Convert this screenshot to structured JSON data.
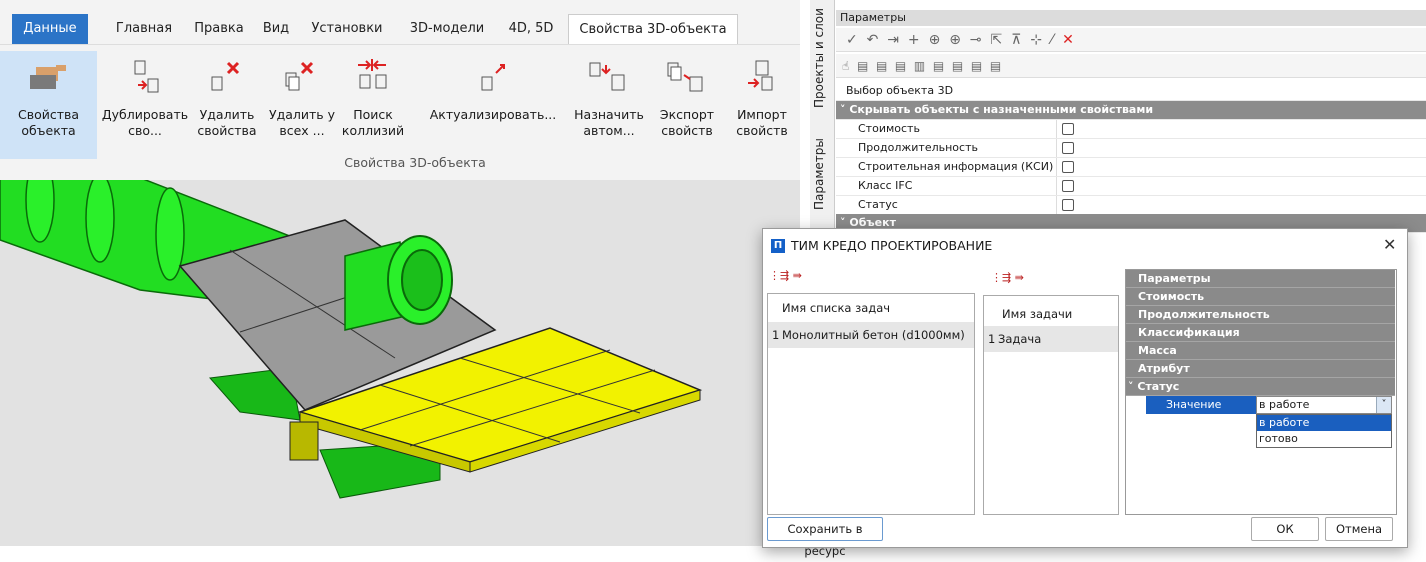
{
  "ribbon": {
    "tabs": [
      "Данные",
      "Главная",
      "Правка",
      "Вид",
      "Установки",
      "3D-модели",
      "4D, 5D",
      "Свойства 3D-объекта"
    ],
    "buttons": [
      {
        "label": "Свойства\nобъекта"
      },
      {
        "label": "Дублировать\nсво..."
      },
      {
        "label": "Удалить\nсвойства"
      },
      {
        "label": "Удалить у\nвсех ..."
      },
      {
        "label": "Поиск\nколлизий"
      },
      {
        "label": "Актуализировать..."
      },
      {
        "label": "Назначить\nавтом..."
      },
      {
        "label": "Экспорт\nсвойств"
      },
      {
        "label": "Импорт\nсвойств"
      }
    ],
    "group_label": "Свойства 3D-объекта"
  },
  "dock": {
    "vertical_tabs": [
      "Проекты и слои",
      "Параметры"
    ],
    "title": "Параметры",
    "toolbar1_icons": [
      "check-icon",
      "undo-icon",
      "end-icon",
      "plus-icon",
      "target-icon",
      "target-icon",
      "node-icon",
      "select-icon",
      "align-icon",
      "dimension-icon",
      "brush-icon",
      "close-icon"
    ],
    "rows": [
      {
        "type": "plain",
        "label": "Выбор объекта 3D"
      },
      {
        "type": "section",
        "label": "Скрывать объекты с назначенными свойствами"
      },
      {
        "type": "check",
        "label": "Стоимость",
        "checked": false
      },
      {
        "type": "check",
        "label": "Продолжительность",
        "checked": false
      },
      {
        "type": "check",
        "label": "Строительная информация (КСИ)",
        "checked": false
      },
      {
        "type": "check",
        "label": "Класс IFC",
        "checked": false
      },
      {
        "type": "check",
        "label": "Статус",
        "checked": false
      },
      {
        "type": "section",
        "label": "Объект"
      }
    ]
  },
  "dialog": {
    "app_icon": "П",
    "title": "ТИМ КРЕДО ПРОЕКТИРОВАНИЕ",
    "task_lists": {
      "header": "Имя списка задач",
      "rows": [
        {
          "num": "1",
          "name": "Монолитный бетон (d1000мм)"
        }
      ]
    },
    "tasks": {
      "header": "Имя задачи",
      "rows": [
        {
          "num": "1",
          "name": "Задача"
        }
      ]
    },
    "categories": [
      "Параметры",
      "Стоимость",
      "Продолжительность",
      "Классификация",
      "Масса",
      "Атрибут",
      "Статус"
    ],
    "status": {
      "field_label": "Значение",
      "selected": "в работе",
      "options": [
        "в работе",
        "готово"
      ]
    },
    "buttons": {
      "save": "Сохранить в ресурс",
      "ok": "ОК",
      "cancel": "Отмена"
    }
  },
  "colors": {
    "accent": "#2b74c7",
    "selection": "#1a5fbf",
    "pipe": "#22e022",
    "slab": "#f2f200",
    "gray_slab": "#9a9a9a"
  }
}
